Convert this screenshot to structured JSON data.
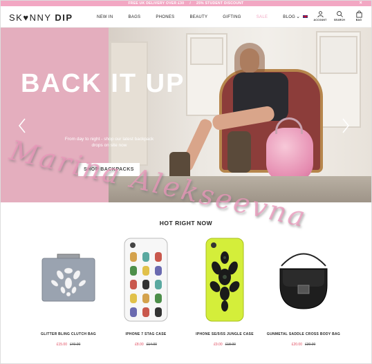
{
  "topbar": {
    "promo_1": "FREE UK DELIVERY OVER £30",
    "separator": "/",
    "promo_2": "25% STUDENT DISCOUNT",
    "close": "×"
  },
  "header": {
    "logo_light": "SK",
    "logo_mid": "NNY",
    "logo_bold": "DIP",
    "nav": [
      "NEW IN",
      "BAGS",
      "PHONES",
      "BEAUTY",
      "GIFTING",
      "SALE",
      "BLOG"
    ],
    "account_label": "ACCOUNT",
    "search_label": "SEARCH",
    "bag_label": "BAG",
    "country_chevron": "⌄"
  },
  "hero": {
    "title": "BACK IT UP",
    "subtitle": "From day to night - shop our latest backpack drops on site now",
    "cta": "SHOP BACKPACKS"
  },
  "watermark": "Marina Alekseevna",
  "section": {
    "title": "HOT RIGHT NOW"
  },
  "products": [
    {
      "name": "GLITTER BLING CLUTCH BAG",
      "price": "£15.00",
      "was": "£40.00"
    },
    {
      "name": "IPHONE 7 STAG CASE",
      "price": "£8.00",
      "was": "£14.00"
    },
    {
      "name": "IPHONE SE/5/5S JUNGLE CASE",
      "price": "£9.00",
      "was": "£18.00"
    },
    {
      "name": "GUNMETAL SADDLE CROSS BODY BAG",
      "price": "£20.00",
      "was": "£30.00"
    }
  ],
  "colors": {
    "brand_pink": "#f2a7c3",
    "hero_pink": "#e4aebe",
    "sale_price": "#e0475b"
  }
}
